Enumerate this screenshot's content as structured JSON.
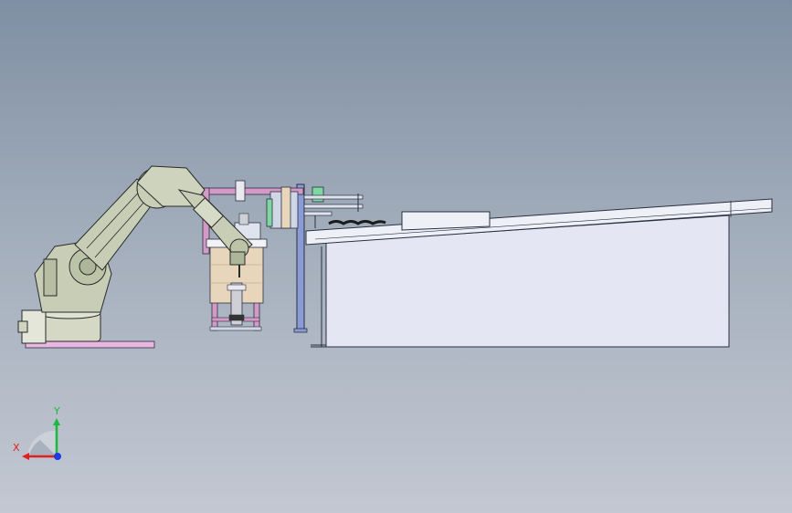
{
  "triad": {
    "x_label": "X",
    "y_label": "Y"
  },
  "colors": {
    "background_top": "#7f8fa3",
    "background_bottom": "#c3c8d2",
    "robot_body": "#c7ceb5",
    "robot_outline": "#2a2a2a",
    "base_plate": "#e9b7e2",
    "frame_pink": "#d49ac7",
    "fixture_tan": "#e8d6bc",
    "conveyor_fill": "#e4e6f3",
    "conveyor_outline": "#2b2f3f",
    "post_blue": "#8a9bd6",
    "green_part": "#7fd6a0",
    "x_axis": "#e21f1f",
    "y_axis": "#19b93a",
    "z_axis": "#1f3be2"
  }
}
